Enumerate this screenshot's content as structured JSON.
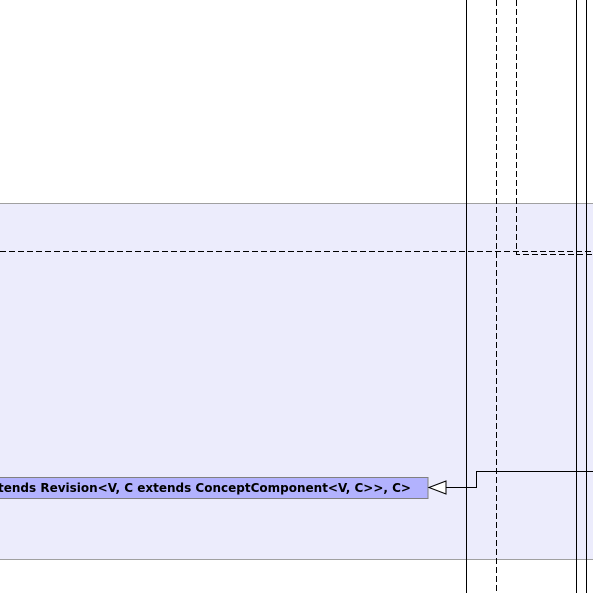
{
  "colors": {
    "page_background": "#ffffff",
    "package_fill": "#ececfc",
    "package_border": "#a0a0a0",
    "class_fill": "#b2b2fe",
    "class_border": "#808080",
    "line": "#000000"
  },
  "diagram": {
    "class_box": {
      "label": "tends Revision<V, C extends ConceptComponent<V, C>>, C>"
    },
    "relationship": {
      "type": "generalization",
      "arrowhead": "hollow-triangle"
    }
  }
}
